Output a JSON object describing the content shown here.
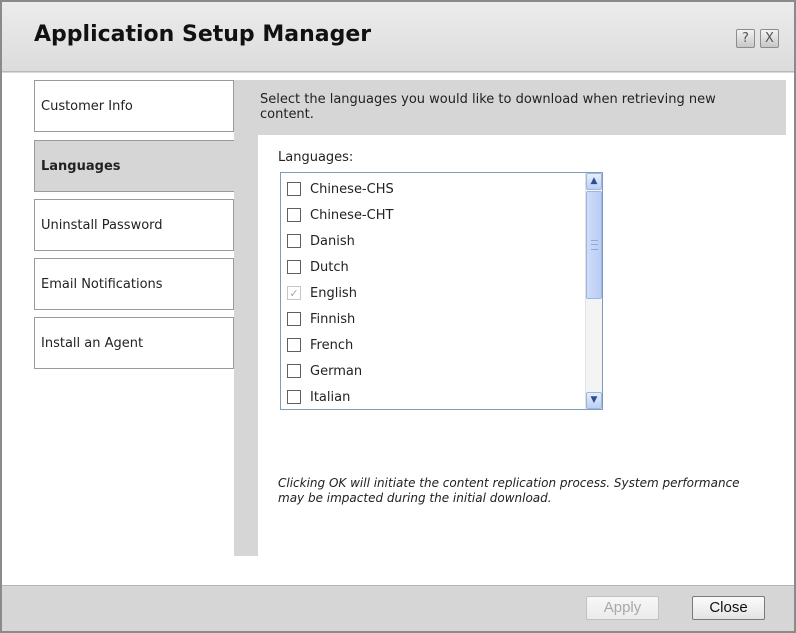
{
  "dialog": {
    "title": "Application Setup Manager",
    "help_label": "?",
    "close_label": "X"
  },
  "sidebar": {
    "items": [
      {
        "label": "Customer Info",
        "active": false
      },
      {
        "label": "Languages",
        "active": true
      },
      {
        "label": "Uninstall Password",
        "active": false
      },
      {
        "label": "Email Notifications",
        "active": false
      },
      {
        "label": "Install an Agent",
        "active": false
      }
    ]
  },
  "panel": {
    "header": "Select the languages you would like to download when retrieving new content.",
    "languages_label": "Languages:",
    "languages": [
      {
        "name": "Chinese-CHS",
        "checked": false,
        "disabled": false
      },
      {
        "name": "Chinese-CHT",
        "checked": false,
        "disabled": false
      },
      {
        "name": "Danish",
        "checked": false,
        "disabled": false
      },
      {
        "name": "Dutch",
        "checked": false,
        "disabled": false
      },
      {
        "name": "English",
        "checked": true,
        "disabled": true
      },
      {
        "name": "Finnish",
        "checked": false,
        "disabled": false
      },
      {
        "name": "French",
        "checked": false,
        "disabled": false
      },
      {
        "name": "German",
        "checked": false,
        "disabled": false
      },
      {
        "name": "Italian",
        "checked": false,
        "disabled": false
      }
    ],
    "note": "Clicking OK will initiate the content replication process. System performance may be impacted during the initial download."
  },
  "footer": {
    "apply_label": "Apply",
    "close_label": "Close"
  },
  "icons": {
    "checkmark": "✓",
    "scroll_up": "▲",
    "scroll_down": "▼"
  }
}
